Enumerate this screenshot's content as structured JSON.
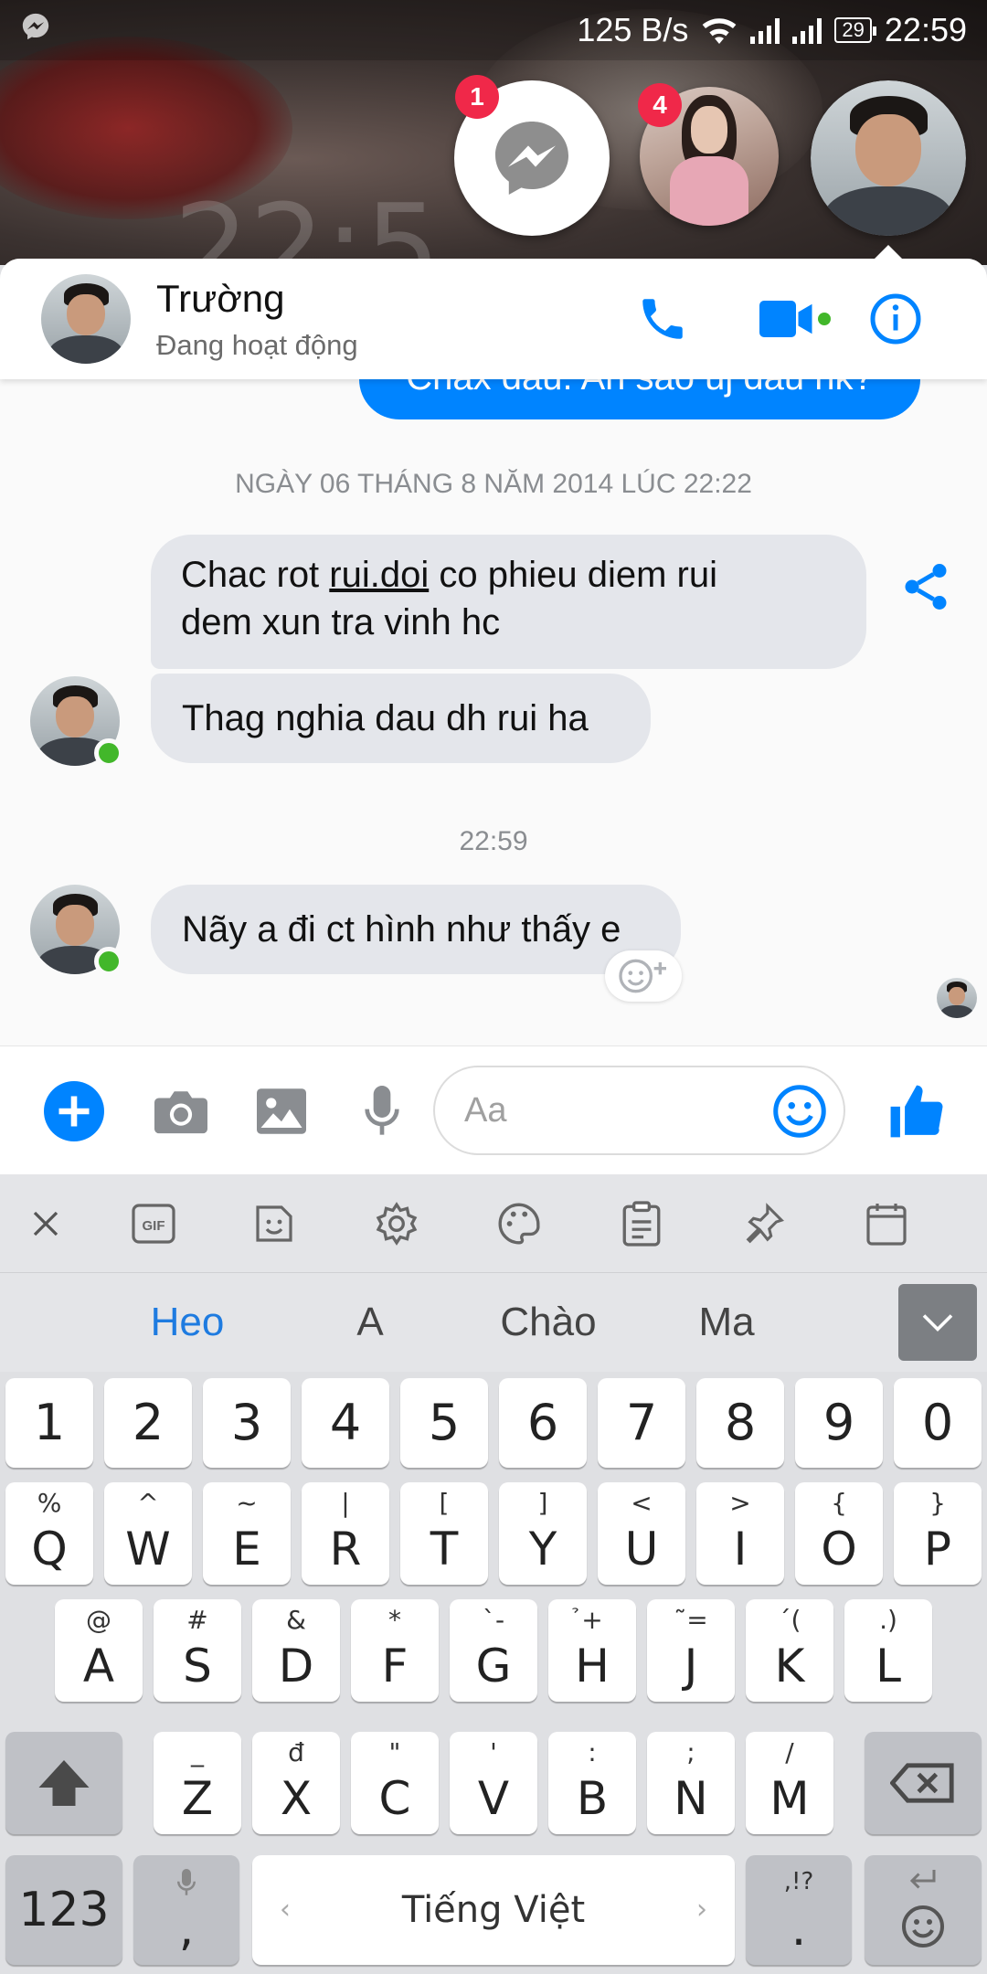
{
  "status_bar": {
    "net_speed": "125 B/s",
    "battery": "29",
    "time": "22:59",
    "icons": [
      "messenger-notification-icon",
      "wifi-icon",
      "signal-icon",
      "signal-icon",
      "battery-icon"
    ]
  },
  "chat_heads": [
    {
      "name": "messenger",
      "badge": "1"
    },
    {
      "name": "contact-girl",
      "badge": "4"
    },
    {
      "name": "contact-truong",
      "badge": ""
    }
  ],
  "header": {
    "contact_name": "Trường",
    "status": "Đang hoạt động",
    "colors": {
      "accent": "#0084ff",
      "online": "#42b72a"
    }
  },
  "messages": {
    "previous_outgoing": "Chax dau. An sao uj dau nk?",
    "date_separator": "NGÀY 06 THÁNG 8 NĂM 2014 LÚC 22:22",
    "msg1_before_link": "Chac rot ",
    "msg1_link": "rui.doi",
    "msg1_after_link": " co phieu diem rui",
    "msg1_line2": "dem xun tra vinh hc",
    "msg2": "Thag nghia dau dh rui ha",
    "time_separator": "22:59",
    "msg3": "Nãy a đi ct hình như thấy e"
  },
  "composer": {
    "placeholder": "Aa",
    "value": ""
  },
  "keyboard": {
    "suggestions": [
      "Heo",
      "A",
      "Chào",
      "Ma"
    ],
    "numbers": [
      "1",
      "2",
      "3",
      "4",
      "5",
      "6",
      "7",
      "8",
      "9",
      "0"
    ],
    "row1": [
      {
        "main": "Q",
        "sub": "%"
      },
      {
        "main": "W",
        "sub": "^"
      },
      {
        "main": "E",
        "sub": "~"
      },
      {
        "main": "R",
        "sub": "|"
      },
      {
        "main": "T",
        "sub": "["
      },
      {
        "main": "Y",
        "sub": "]"
      },
      {
        "main": "U",
        "sub": "<"
      },
      {
        "main": "I",
        "sub": ">"
      },
      {
        "main": "O",
        "sub": "{"
      },
      {
        "main": "P",
        "sub": "}"
      }
    ],
    "row2": [
      {
        "main": "A",
        "sub": "@"
      },
      {
        "main": "S",
        "sub": "#"
      },
      {
        "main": "D",
        "sub": "&"
      },
      {
        "main": "F",
        "sub": "*"
      },
      {
        "main": "G",
        "sub": "`-"
      },
      {
        "main": "H",
        "sub": "̉+"
      },
      {
        "main": "J",
        "sub": "˜="
      },
      {
        "main": "K",
        "sub": "´("
      },
      {
        "main": "L",
        "sub": ".)"
      }
    ],
    "row3": [
      {
        "main": "Z",
        "sub": "_"
      },
      {
        "main": "X",
        "sub": "đ"
      },
      {
        "main": "C",
        "sub": "\""
      },
      {
        "main": "V",
        "sub": "'"
      },
      {
        "main": "B",
        "sub": ":"
      },
      {
        "main": "N",
        "sub": ";"
      },
      {
        "main": "M",
        "sub": "/"
      }
    ],
    "mode_key": "123",
    "comma_key": ",",
    "space_label": "Tiếng Việt",
    "period_key": ".",
    "period_sub": ",!?"
  }
}
